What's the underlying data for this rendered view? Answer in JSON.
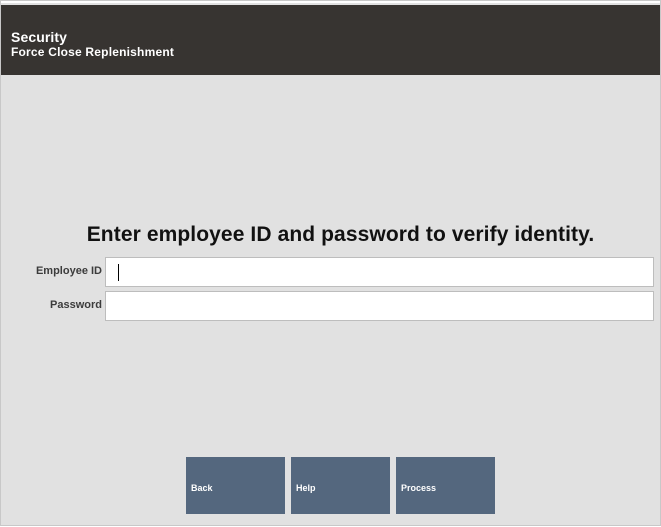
{
  "header": {
    "title": "Security",
    "subtitle": "Force Close Replenishment"
  },
  "prompt": "Enter employee ID and password to verify identity.",
  "fields": {
    "employee_id": {
      "label": "Employee ID",
      "value": ""
    },
    "password": {
      "label": "Password",
      "value": ""
    }
  },
  "buttons": {
    "back": "Back",
    "help": "Help",
    "process": "Process"
  },
  "colors": {
    "header_bg": "#373431",
    "body_bg": "#e1e1e1",
    "button_bg": "#54677e"
  }
}
